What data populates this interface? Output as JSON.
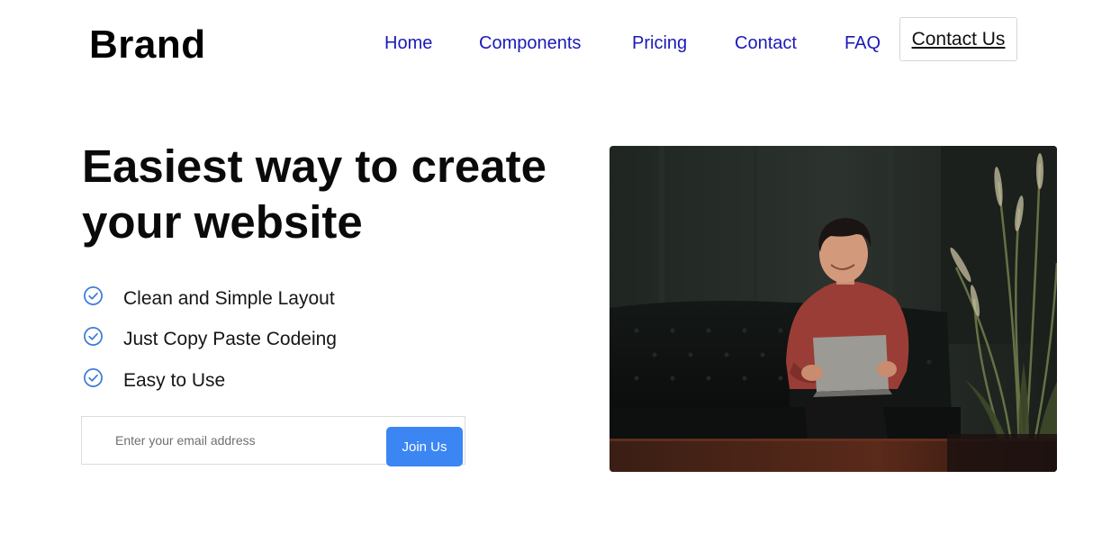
{
  "header": {
    "brand": "Brand",
    "nav": [
      "Home",
      "Components",
      "Pricing",
      "Contact",
      "FAQ"
    ],
    "cta_label": "Contact Us"
  },
  "hero": {
    "title": "Easiest way to create your website",
    "features": [
      "Clean and Simple Layout",
      "Just Copy Paste Codeing",
      "Easy to Use"
    ],
    "email_placeholder": "Enter your email address",
    "join_label": "Join Us"
  },
  "colors": {
    "nav_link": "#1a1ab8",
    "check_icon": "#3b7bd8",
    "join_button": "#3b86f3"
  },
  "icons": {
    "feature": "check-circle-icon"
  }
}
